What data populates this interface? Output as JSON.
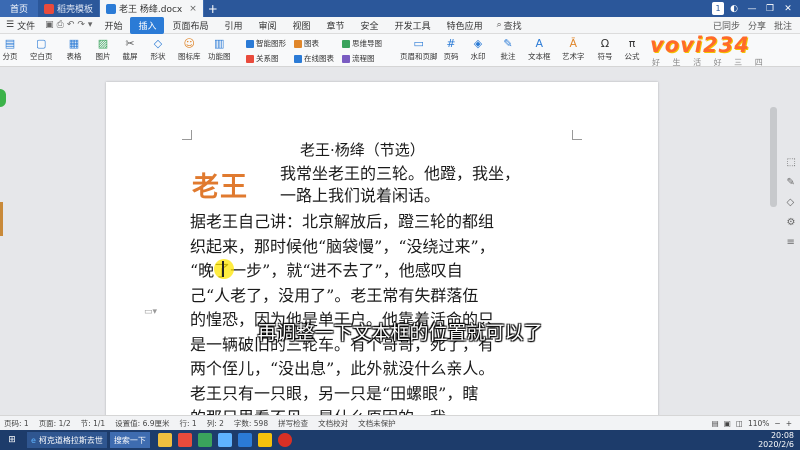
{
  "tabs": {
    "home": "首页",
    "template_tab": "稻壳模板",
    "doc_tab": "老王 杨绛.docx",
    "badge": "1"
  },
  "menu": {
    "file": "文件",
    "items": [
      "开始",
      "插入",
      "页面布局",
      "引用",
      "审阅",
      "视图",
      "章节",
      "安全",
      "开发工具",
      "特色应用"
    ],
    "active_index": 1,
    "search": "查找",
    "sync": "已同步",
    "share": "分享",
    "comment": "批注"
  },
  "ribbon": {
    "large": [
      "分页",
      "空白页",
      "表格",
      "图片",
      "截屏",
      "形状",
      "图标库",
      "功能图",
      "页眉和页脚",
      "页码",
      "水印",
      "批注",
      "文本框",
      "艺术字",
      "符号",
      "公式"
    ],
    "small": [
      "智能图形",
      "图表",
      "思维导图",
      "关系图",
      "在线图表",
      "流程图"
    ]
  },
  "logo": {
    "text": "vovi234",
    "sub": "好 生 活 好 三 四"
  },
  "document": {
    "title": "老王·杨绛（节选）",
    "wordart": "老王",
    "head_lines": [
      "我常坐老王的三轮。他蹬，我坐，",
      "一路上我们说着闲话。"
    ],
    "body_lines": [
      "据老王自己讲：北京解放后，蹬三轮的都组",
      "织起来，那时候他“脑袋慢”，“没绕过来”，",
      "“晚了一步”，就“进不去了”，他感叹自",
      "己“人老了，没用了”。老王常有失群落伍",
      "的惶恐，因为他是单干户。他靠着活命的只",
      "是一辆破旧的三轮车。有个哥哥，死了，有",
      "两个侄儿，“没出息”，此外就没什么亲人。",
      "老王只有一只眼，另一只是“田螺眼”，瞎",
      "的那只里看不见，是什么原因的，我"
    ]
  },
  "subtitle": "再调整一下文本框的位置就可以了",
  "status": {
    "page": "页码: 1",
    "pages": "页面: 1/2",
    "section": "节: 1/1",
    "setting": "设置值: 6.9厘米",
    "row": "行: 1",
    "col": "列: 2",
    "words": "字数: 598",
    "spell": "拼写检查",
    "proof": "文档校对",
    "protect": "文档未保护",
    "zoom": "110%"
  },
  "taskbar": {
    "items": [
      "柯克道格拉斯去世",
      "搜索一下"
    ],
    "time": "20:08",
    "date": "2020/2/6"
  }
}
